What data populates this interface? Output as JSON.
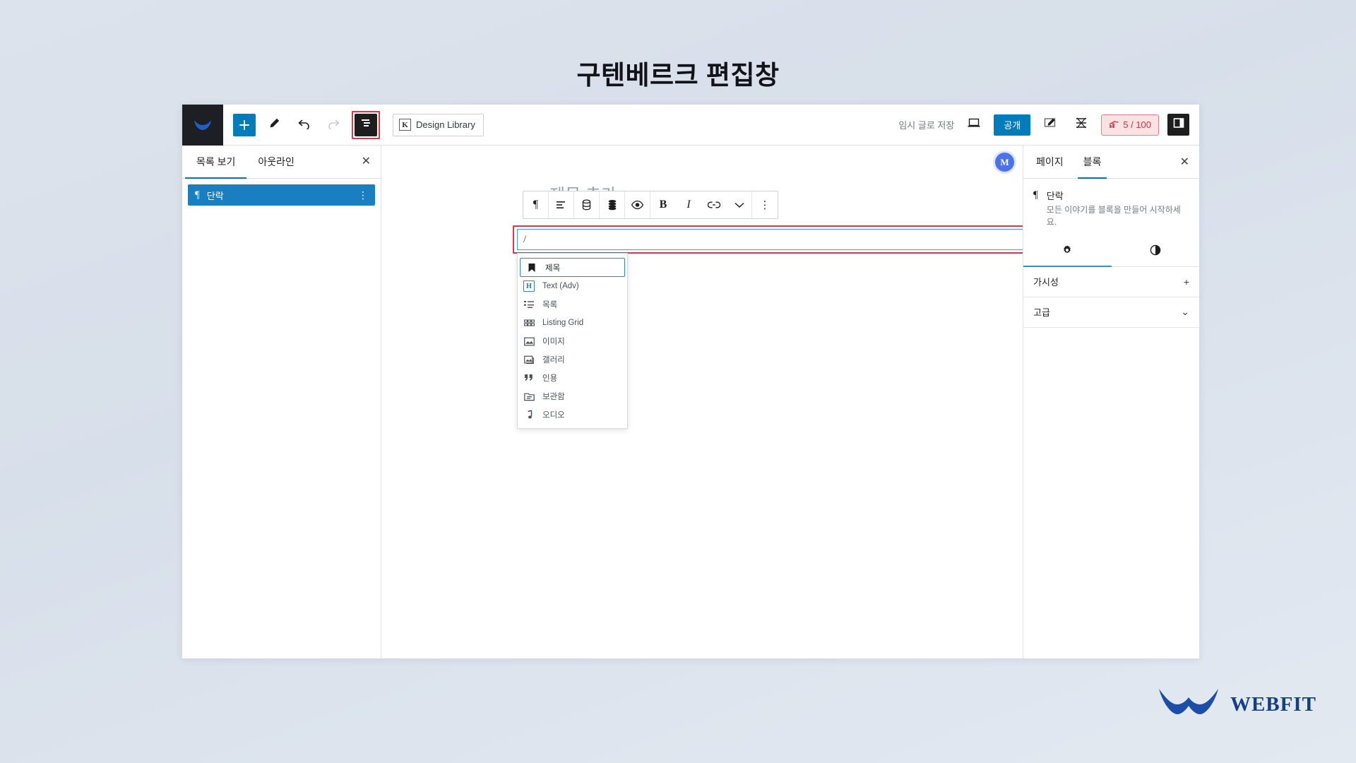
{
  "page": {
    "heading": "구텐베르크 편집창"
  },
  "topbar": {
    "logo_icon": "wordpress-w-logo",
    "add_block_icon": "plus-icon",
    "add_block_label": "+",
    "tools_icon": "pencil-icon",
    "undo_icon": "undo-arrow-icon",
    "redo_icon": "redo-arrow-icon",
    "list_view_icon": "list-view-icon",
    "design_library": {
      "label": "Design Library",
      "icon": "design-library-icon",
      "icon_glyph": "K"
    },
    "save_draft_label": "임시 글로 저장",
    "preview_icon": "laptop-preview-icon",
    "publish_label": "공개",
    "edit_icon": "pencil-square-icon",
    "seo_settings_icon": "seo-gear-icon",
    "seo_badge": {
      "icon": "seo-score-icon",
      "score": "5 / 100"
    },
    "sidebar_toggle_icon": "sidebar-panel-icon"
  },
  "list_view": {
    "tabs": [
      {
        "label": "목록 보기",
        "active": true
      },
      {
        "label": "아웃라인",
        "active": false
      }
    ],
    "close_icon": "close-icon",
    "close_glyph": "✕",
    "blocks": [
      {
        "icon": "paragraph-pilcrow-icon",
        "icon_glyph": "¶",
        "label": "단락",
        "menu_icon": "vertical-dots-icon",
        "menu_glyph": "⋮"
      }
    ]
  },
  "canvas": {
    "title_placeholder": "제목 추가",
    "paragraph_value": "/",
    "block_toolbar": [
      {
        "name": "paragraph-type-icon",
        "glyph": "¶"
      },
      {
        "name": "align-icon",
        "glyph": ""
      },
      {
        "name": "database-icon",
        "glyph": ""
      },
      {
        "name": "stack-icon",
        "glyph": ""
      },
      {
        "name": "visibility-eye-icon",
        "glyph": ""
      },
      {
        "name": "bold-icon",
        "glyph": "B"
      },
      {
        "name": "italic-icon",
        "glyph": "I"
      },
      {
        "name": "link-icon",
        "glyph": ""
      },
      {
        "name": "chevron-down-icon",
        "glyph": ""
      },
      {
        "name": "more-options-icon",
        "glyph": "⋮"
      }
    ],
    "slash_menu": [
      {
        "label": "제목",
        "icon": "heading-bookmark-icon",
        "focused": true
      },
      {
        "label": "Text (Adv)",
        "icon": "heading-h-icon",
        "icon_glyph": "H",
        "focused": false
      },
      {
        "label": "목록",
        "icon": "list-icon",
        "focused": false
      },
      {
        "label": "Listing Grid",
        "icon": "listing-grid-icon",
        "focused": false
      },
      {
        "label": "이미지",
        "icon": "image-icon",
        "focused": false
      },
      {
        "label": "갤러리",
        "icon": "gallery-icon",
        "focused": false
      },
      {
        "label": "인용",
        "icon": "quote-icon",
        "focused": false
      },
      {
        "label": "보관함",
        "icon": "archive-icon",
        "focused": false
      },
      {
        "label": "오디오",
        "icon": "audio-note-icon",
        "focused": false
      }
    ]
  },
  "settings_sidebar": {
    "plugin_badge_glyph": "M",
    "plugin_badge_name": "plugin-badge-icon",
    "tabs": [
      {
        "label": "페이지",
        "active": false
      },
      {
        "label": "블록",
        "active": true
      }
    ],
    "close_icon": "close-icon",
    "close_glyph": "✕",
    "block_info": {
      "icon": "paragraph-pilcrow-icon",
      "icon_glyph": "¶",
      "title": "단락",
      "description": "모든 이야기를 블록을 만들어 시작하세요."
    },
    "subtabs": [
      {
        "name": "settings-gear-tab",
        "active": true
      },
      {
        "name": "styles-contrast-tab",
        "active": false
      }
    ],
    "rows": [
      {
        "label": "가시성",
        "control_icon": "plus-icon",
        "control_glyph": "+"
      },
      {
        "label": "고급",
        "control_icon": "chevron-down-icon",
        "control_glyph": "⌄"
      }
    ]
  },
  "branding": {
    "logo_name": "webfit-logo",
    "brand_text": "WEBFIT"
  },
  "colors": {
    "accent_blue": "#007cba",
    "selected_block": "#1a7fc1",
    "annotation_red": "#e0364b",
    "seo_red": "#c4373f",
    "brand_blue": "#123f8c",
    "page_background": "#dde3ec"
  }
}
